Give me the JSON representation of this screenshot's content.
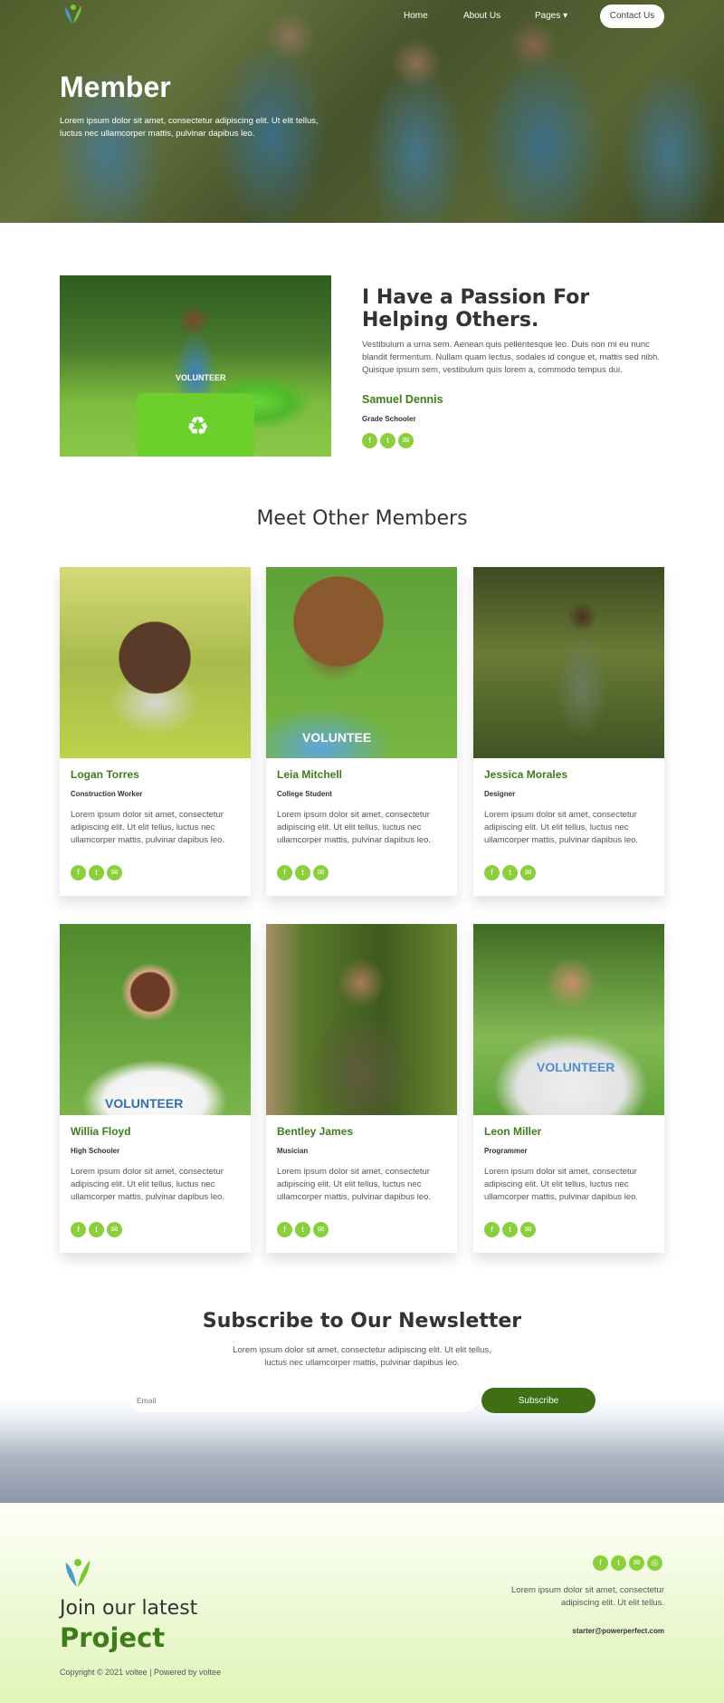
{
  "nav": {
    "home": "Home",
    "about": "About Us",
    "pages": "Pages",
    "pages_caret": "▾",
    "contact": "Contact Us"
  },
  "hero": {
    "title": "Member",
    "description": "Lorem ipsum dolor sit amet, consectetur adipiscing elit. Ut elit tellus, luctus nec ullamcorper mattis, pulvinar dapibus leo."
  },
  "featured": {
    "heading": "I Have a Passion For Helping Others.",
    "description": "Vestibulum a urna sem. Aenean quis pellentesque leo. Duis non mi eu nunc blandit fermentum. Nullam quam lectus, sodales id congue et, mattis sed nibh. Quisque ipsum sem, vestibulum quis lorem a, commodo tempus dui.",
    "name": "Samuel Dennis",
    "role": "Grade Schooler",
    "shirt_text": "VOLUNTEER",
    "crate_icon": "♻"
  },
  "members": {
    "title": "Meet Other Members",
    "items": [
      {
        "name": "Logan Torres",
        "role": "Construction Worker",
        "desc": "Lorem ipsum dolor sit amet, consectetur adipiscing elit. Ut elit tellus, luctus nec ullamcorper mattis, pulvinar dapibus leo."
      },
      {
        "name": "Leia Mitchell",
        "role": "College Student",
        "desc": "Lorem ipsum dolor sit amet, consectetur adipiscing elit. Ut elit tellus, luctus nec ullamcorper mattis, pulvinar dapibus leo.",
        "shirt_text": "VOLUNTEE"
      },
      {
        "name": "Jessica Morales",
        "role": "Designer",
        "desc": "Lorem ipsum dolor sit amet, consectetur adipiscing elit. Ut elit tellus, luctus nec ullamcorper mattis, pulvinar dapibus leo."
      },
      {
        "name": "Willia Floyd",
        "role": "High Schooler",
        "desc": "Lorem ipsum dolor sit amet, consectetur adipiscing elit. Ut elit tellus, luctus nec ullamcorper mattis, pulvinar dapibus leo.",
        "shirt_text": "VOLUNTEER"
      },
      {
        "name": "Bentley James",
        "role": "Musician",
        "desc": "Lorem ipsum dolor sit amet, consectetur adipiscing elit. Ut elit tellus, luctus nec ullamcorper mattis, pulvinar dapibus leo."
      },
      {
        "name": "Leon Miller",
        "role": "Programmer",
        "desc": "Lorem ipsum dolor sit amet, consectetur adipiscing elit. Ut elit tellus, luctus nec ullamcorper mattis, pulvinar dapibus leo.",
        "shirt_text": "VOLUNTEER"
      }
    ]
  },
  "social_icons": {
    "facebook": "f",
    "twitter": "t",
    "email": "✉",
    "instagram": "◎"
  },
  "newsletter": {
    "title": "Subscribe to Our Newsletter",
    "description": "Lorem ipsum dolor sit amet, consectetur adipiscing elit. Ut elit tellus, luctus nec ullamcorper mattis, pulvinar dapibus leo.",
    "email_placeholder": "Email",
    "button": "Subscribe"
  },
  "footer": {
    "join": "Join our latest",
    "project": "Project",
    "copyright": "Copyright © 2021 voltee | Powered by voltee",
    "description": "Lorem ipsum dolor sit amet, consectetur adipiscing elit. Ut elit tellus.",
    "email": "starter@powerperfect.com"
  },
  "colors": {
    "accent_green": "#3e7d1a",
    "social_green": "#8ccf3c",
    "button_green": "#3f6f14"
  }
}
